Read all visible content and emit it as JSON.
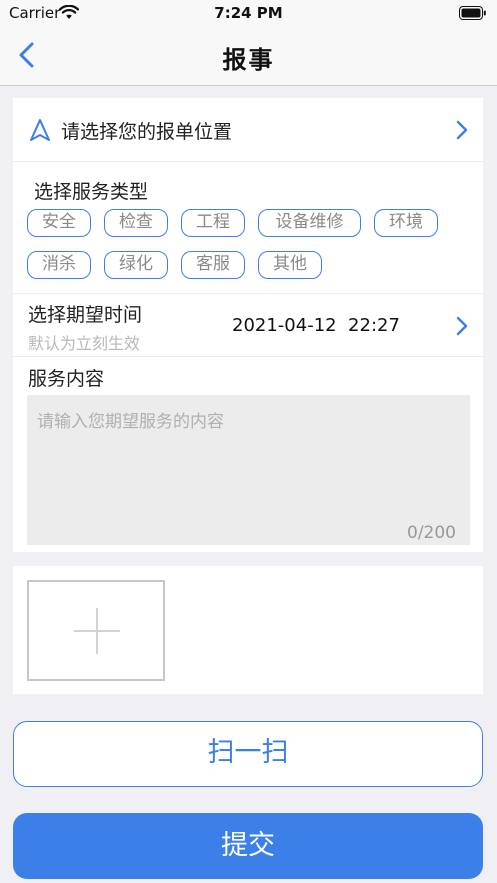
{
  "status_bar": {
    "carrier": "Carrier",
    "time": "7:24 PM",
    "wifi_icon": "wifi-icon",
    "battery_icon": "battery-icon"
  },
  "nav": {
    "back_icon": "chevron-left-icon",
    "title": "报事"
  },
  "location": {
    "icon": "navigation-arrow-icon",
    "label": "请选择您的报单位置",
    "chevron_icon": "chevron-right-icon"
  },
  "service_type": {
    "title": "选择服务类型",
    "tags": [
      "安全",
      "检查",
      "工程",
      "设备维修",
      "环境",
      "消杀",
      "绿化",
      "客服",
      "其他"
    ]
  },
  "time": {
    "title": "选择期望时间",
    "hint": "默认为立刻生效",
    "value": "2021-04-12  22:27",
    "chevron_icon": "chevron-right-icon"
  },
  "content": {
    "title": "服务内容",
    "placeholder": "请输入您期望服务的内容",
    "counter": "0/200"
  },
  "photo": {
    "add_icon": "plus-icon"
  },
  "actions": {
    "scan_label": "扫一扫",
    "submit_label": "提交"
  },
  "colors": {
    "accent": "#3b7fe8",
    "background": "#efeff4",
    "placeholder": "#b0b0b0"
  }
}
